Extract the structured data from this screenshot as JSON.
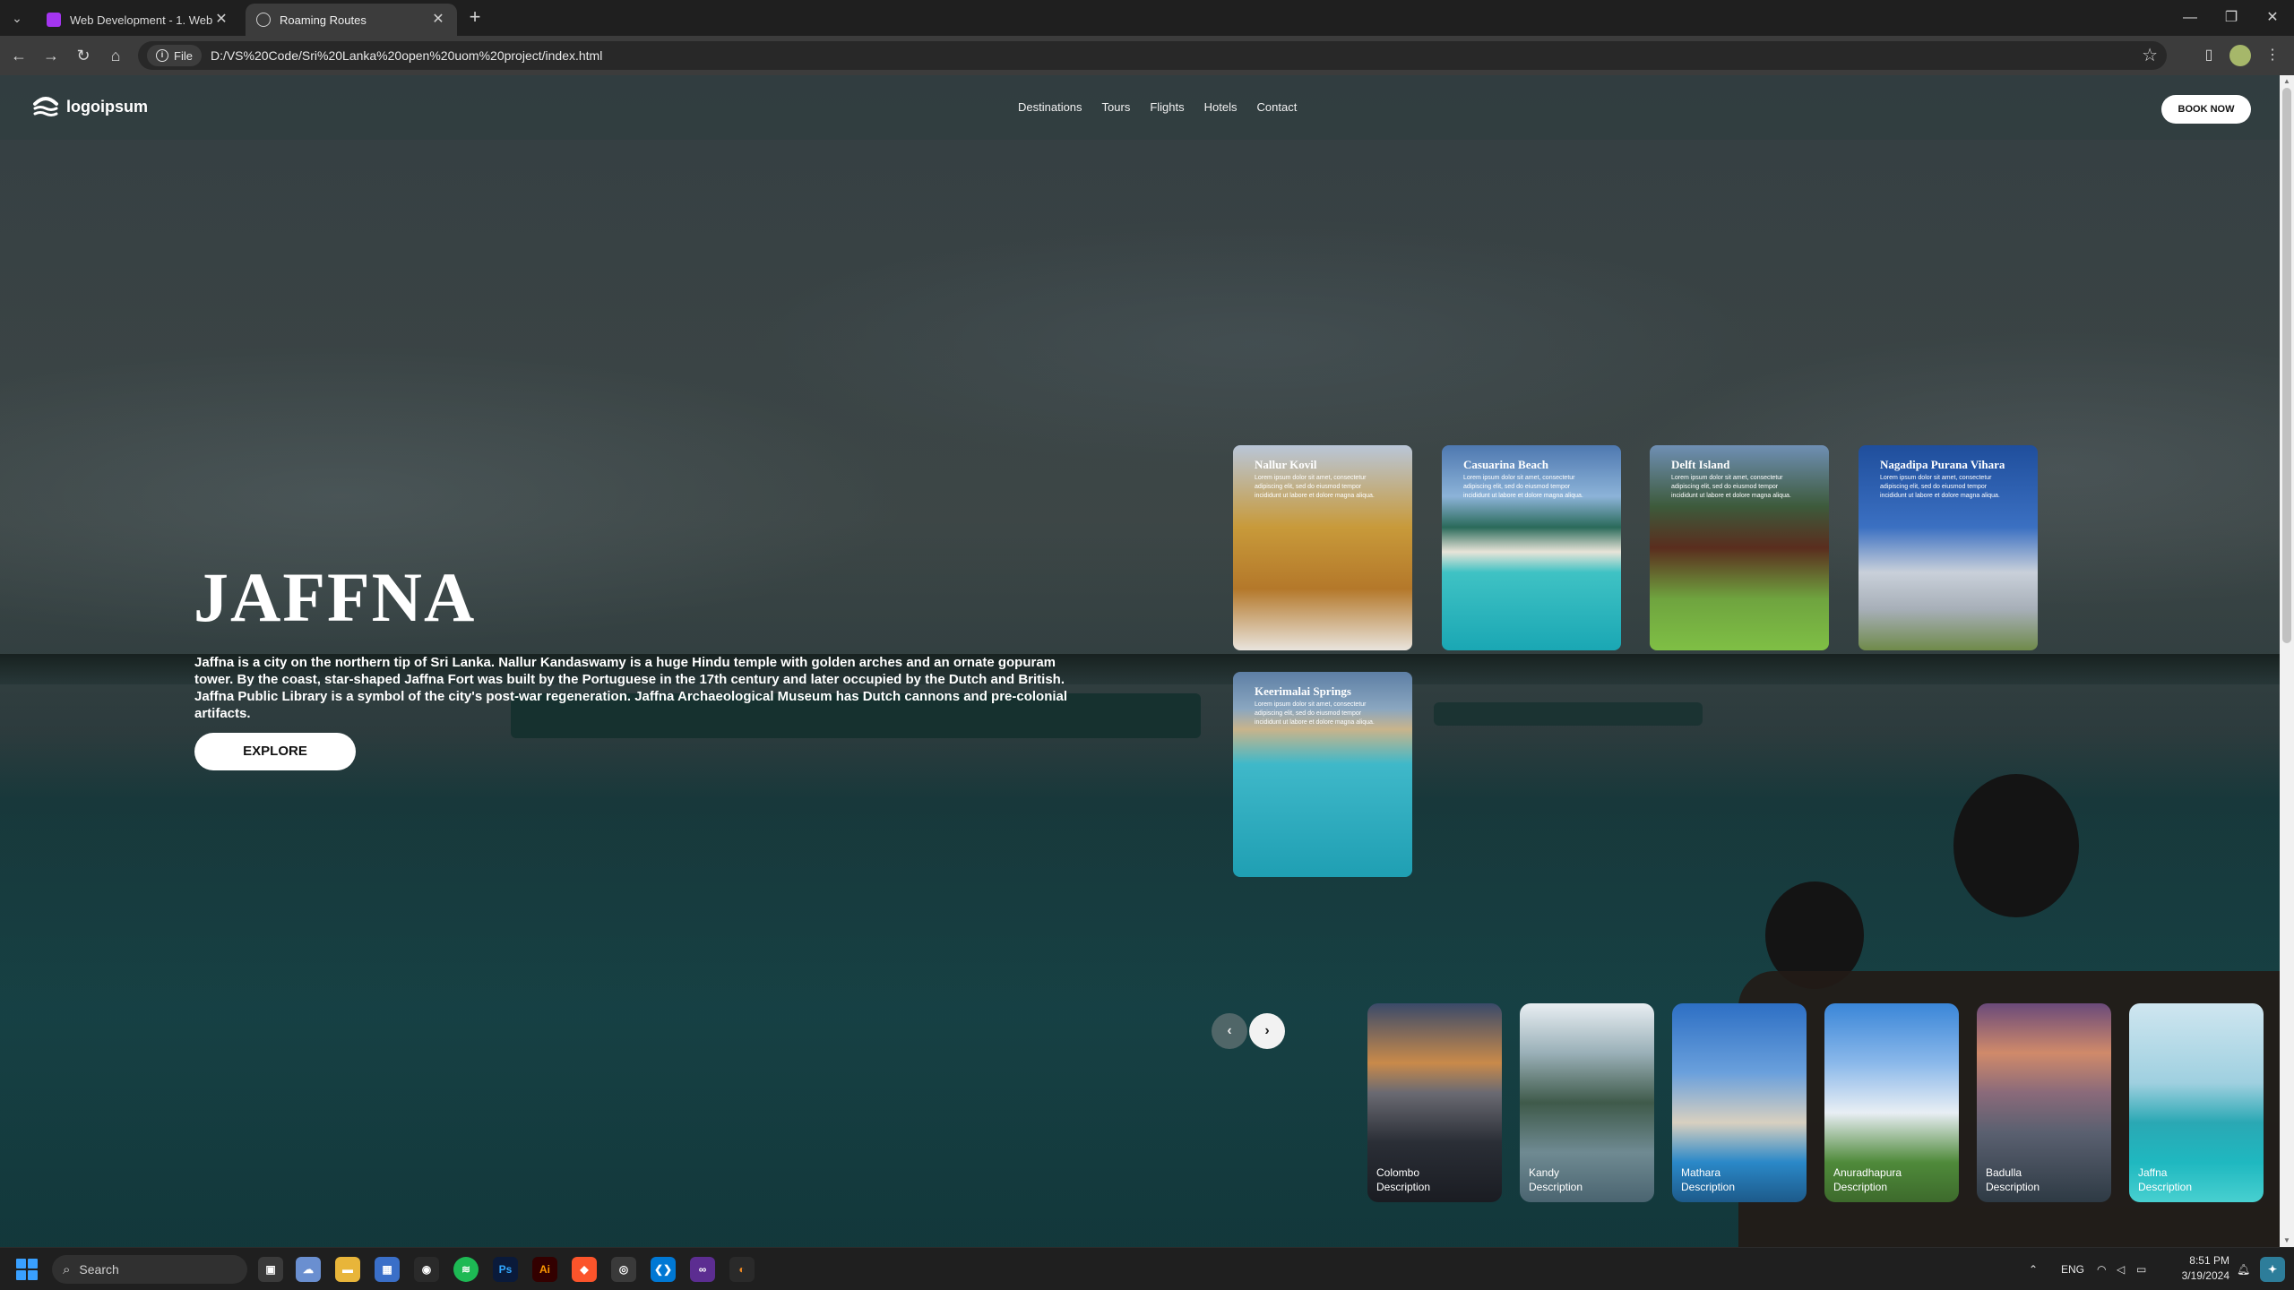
{
  "browser": {
    "tabs": [
      {
        "label": "Web Development - 1. Web De",
        "active": false
      },
      {
        "label": "Roaming Routes",
        "active": true
      }
    ],
    "new_tab_label": "+",
    "address_chip": "File",
    "url": "D:/VS%20Code/Sri%20Lanka%20open%20uom%20project/index.html"
  },
  "site": {
    "logo_text": "logoipsum",
    "nav": [
      "Destinations",
      "Tours",
      "Flights",
      "Hotels",
      "Contact"
    ],
    "book_now": "BOOK NOW"
  },
  "hero": {
    "title": "JAFFNA",
    "description": "Jaffna is a city on the northern tip of Sri Lanka. Nallur Kandaswamy is a huge Hindu temple with golden arches and an ornate gopuram tower. By the coast, star-shaped Jaffna Fort was built by the Portuguese in the 17th century and later occupied by the Dutch and British. Jaffna Public Library is a symbol of the city's post-war regeneration. Jaffna Archaeological Museum has Dutch cannons and pre-colonial artifacts.",
    "explore": "EXPLORE"
  },
  "attractions": [
    {
      "title": "Nallur Kovil",
      "text": "Lorem ipsum dolor sit amet, consectetur adipiscing elit, sed do eiusmod tempor incididunt ut labore et dolore magna aliqua."
    },
    {
      "title": "Casuarina Beach",
      "text": "Lorem ipsum dolor sit amet, consectetur adipiscing elit, sed do eiusmod tempor incididunt ut labore et dolore magna aliqua."
    },
    {
      "title": "Delft Island",
      "text": "Lorem ipsum dolor sit amet, consectetur adipiscing elit, sed do eiusmod tempor incididunt ut labore et dolore magna aliqua."
    },
    {
      "title": "Nagadipa Purana Vihara",
      "text": "Lorem ipsum dolor sit amet, consectetur adipiscing elit, sed do eiusmod tempor incididunt ut labore et dolore magna aliqua."
    },
    {
      "title": "Keerimalai Springs",
      "text": "Lorem ipsum dolor sit amet, consectetur adipiscing elit, sed do eiusmod tempor incididunt ut labore et dolore magna aliqua."
    }
  ],
  "slider": {
    "prev": "‹",
    "next": "›"
  },
  "destinations": [
    {
      "name": "Colombo",
      "desc": "Description"
    },
    {
      "name": "Kandy",
      "desc": "Description"
    },
    {
      "name": "Mathara",
      "desc": "Description"
    },
    {
      "name": "Anuradhapura",
      "desc": "Description"
    },
    {
      "name": "Badulla",
      "desc": "Description"
    },
    {
      "name": "Jaffna",
      "desc": "Description"
    }
  ],
  "taskbar": {
    "search_placeholder": "Search",
    "language": "ENG",
    "time": "8:51 PM",
    "date": "3/19/2024"
  },
  "colors": {
    "chrome_bg": "#1f1f1f",
    "toolbar_bg": "#3c3c3c",
    "sea": "#1d5457",
    "accent_button": "#ffffff"
  }
}
